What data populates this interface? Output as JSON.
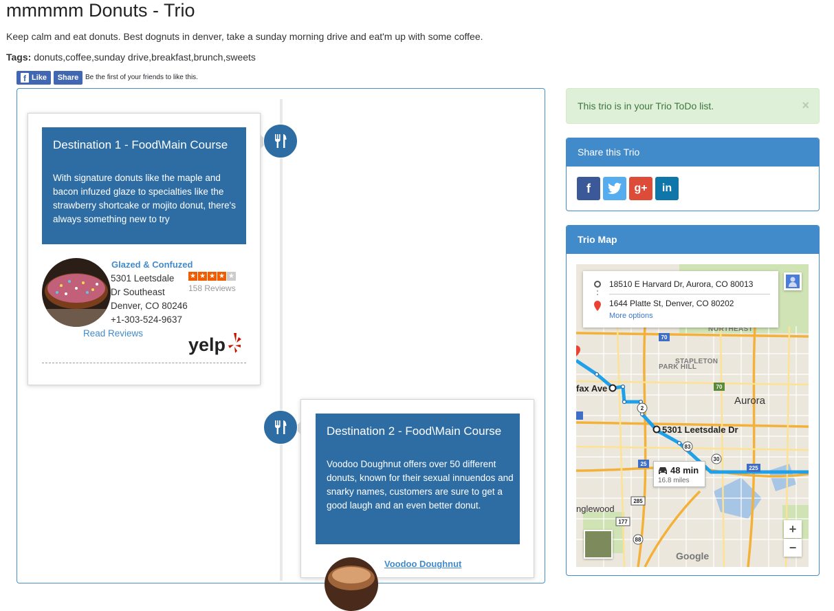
{
  "header": {
    "title": "mmmmm Donuts - Trio",
    "description": "Keep calm and eat donuts. Best dognuts in denver, take a sunday morning drive and eat'm up with some coffee.",
    "tags_label": "Tags:",
    "tags_value": "donuts,coffee,sunday drive,breakfast,brunch,sweets"
  },
  "facebook": {
    "like_label": "Like",
    "share_label": "Share",
    "social_text": "Be the first of your friends to like this."
  },
  "destinations": [
    {
      "title": "Destination 1 - Food\\Main Course",
      "description": "With signature donuts like the maple and bacon infuzed glaze to specialties like the strawberry shortcake or mojito donut, there's always something new to try",
      "icon": "fork-knife-icon",
      "place": {
        "name": "Glazed & Confuzed",
        "address_line1": "5301 Leetsdale",
        "address_line2": "Dr Southeast",
        "address_line3": "Denver, CO 80246",
        "phone": "+1-303-524-9637",
        "rating": 4,
        "rating_max": 5,
        "reviews": "158 Reviews",
        "read_reviews": "Read Reviews",
        "yelp_logo": "yelp"
      }
    },
    {
      "title": "Destination 2 - Food\\Main Course",
      "description": "Voodoo Doughnut offers over 50 different donuts, known for their sexual innuendos and snarky names, customers are sure to get a good laugh and an even better donut.",
      "icon": "fork-knife-icon",
      "place": {
        "name": "Voodoo Doughnut"
      }
    }
  ],
  "alert": {
    "text": "This trio is in your Trio ToDo list.",
    "close": "×"
  },
  "share_panel": {
    "title": "Share this Trio",
    "buttons": [
      {
        "label": "f",
        "icon": "facebook-icon",
        "color": "#3b5998"
      },
      {
        "label": "t",
        "icon": "twitter-icon",
        "color": "#55acee"
      },
      {
        "label": "g+",
        "icon": "google-plus-icon",
        "color": "#dd4b39"
      },
      {
        "label": "in",
        "icon": "linkedin-icon",
        "color": "#0e76a8"
      }
    ]
  },
  "map_panel": {
    "title": "Trio Map",
    "from": "18510 E Harvard Dr, Aurora, CO 80013",
    "to": "1644 Platte St, Denver, CO 80202",
    "more_options": "More options",
    "duration": "48 min",
    "distance": "16.8 miles",
    "zoom_in": "+",
    "zoom_out": "−",
    "labels": {
      "colfax": "fax Ave",
      "leetsdale": "5301 Leetsdale Dr",
      "aurora": "Aurora",
      "englewood": "nglewood",
      "park_hill": "PARK HILL",
      "stapleton": "STAPLETON",
      "northeast": "NORTHEAST"
    },
    "shields": [
      "70",
      "70",
      "2",
      "83",
      "30",
      "225",
      "25",
      "285",
      "177",
      "88",
      "83"
    ],
    "logo": "Google"
  },
  "colors": {
    "primary": "#428bca",
    "dest_box": "#2e6da4",
    "alert_bg": "#dff0d8",
    "alert_text": "#3c763d",
    "route": "#1fa0e8",
    "yelp_red": "#c41200"
  }
}
